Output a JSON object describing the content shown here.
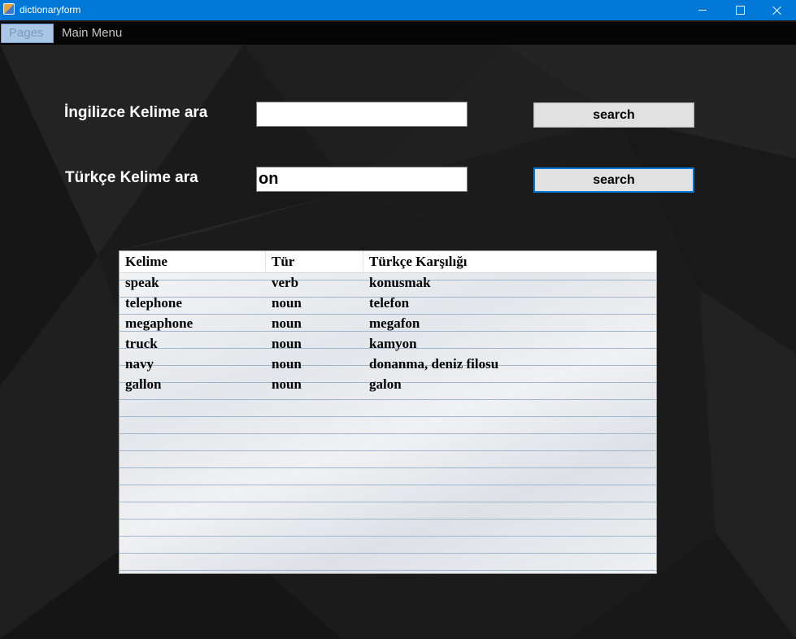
{
  "window": {
    "title": "dictionaryform"
  },
  "menu": {
    "items": [
      {
        "label": "Pages"
      },
      {
        "label": "Main Menu"
      }
    ]
  },
  "search_english": {
    "label": "İngilizce Kelime ara",
    "value": "",
    "button_label": "search"
  },
  "search_turkish": {
    "label": "Türkçe Kelime ara",
    "value": "on",
    "button_label": "search"
  },
  "results": {
    "columns": [
      "Kelime",
      "Tür",
      "Türkçe Karşılığı"
    ],
    "rows": [
      [
        "speak",
        "verb",
        "konusmak"
      ],
      [
        "telephone",
        "noun",
        "telefon"
      ],
      [
        "megaphone",
        "noun",
        "megafon"
      ],
      [
        "truck",
        "noun",
        "kamyon"
      ],
      [
        "navy",
        "noun",
        "donanma, deniz filosu"
      ],
      [
        "gallon",
        "noun",
        "galon"
      ]
    ]
  },
  "colors": {
    "titlebar": "#0078d7",
    "menubar": "#050505",
    "background": "#1a1a1a",
    "focus_border": "#0078d7"
  }
}
